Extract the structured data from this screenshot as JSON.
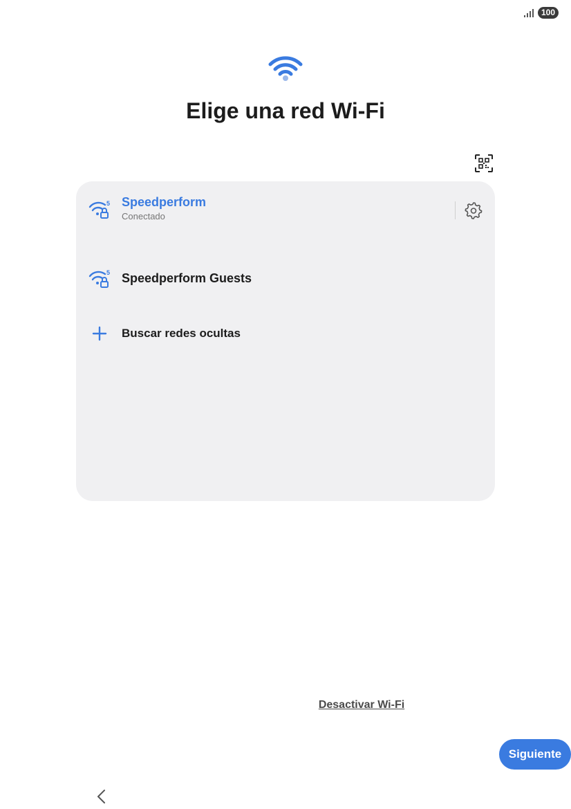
{
  "status_bar": {
    "signal_icon": "signal-bars-icon",
    "battery": "100"
  },
  "header": {
    "icon": "wifi-icon",
    "title": "Elige una red Wi-Fi",
    "qr_icon": "qr-scan-icon"
  },
  "networks": [
    {
      "name": "Speedperform",
      "status": "Conectado",
      "band": "5",
      "icon": "wifi-5ghz-lock-icon",
      "connected": true
    },
    {
      "name": "Speedperform Guests",
      "band": "5",
      "icon": "wifi-5ghz-lock-icon",
      "connected": false
    }
  ],
  "hidden_networks": {
    "label": "Buscar redes ocultas",
    "icon": "plus-icon"
  },
  "footer": {
    "disable_wifi": "Desactivar Wi-Fi",
    "next_button": "Siguiente",
    "back_icon": "chevron-left-icon"
  },
  "colors": {
    "accent": "#3a7be0",
    "card_background": "#f0f0f2",
    "text_primary": "#1c1c1c",
    "text_secondary": "#757575"
  }
}
